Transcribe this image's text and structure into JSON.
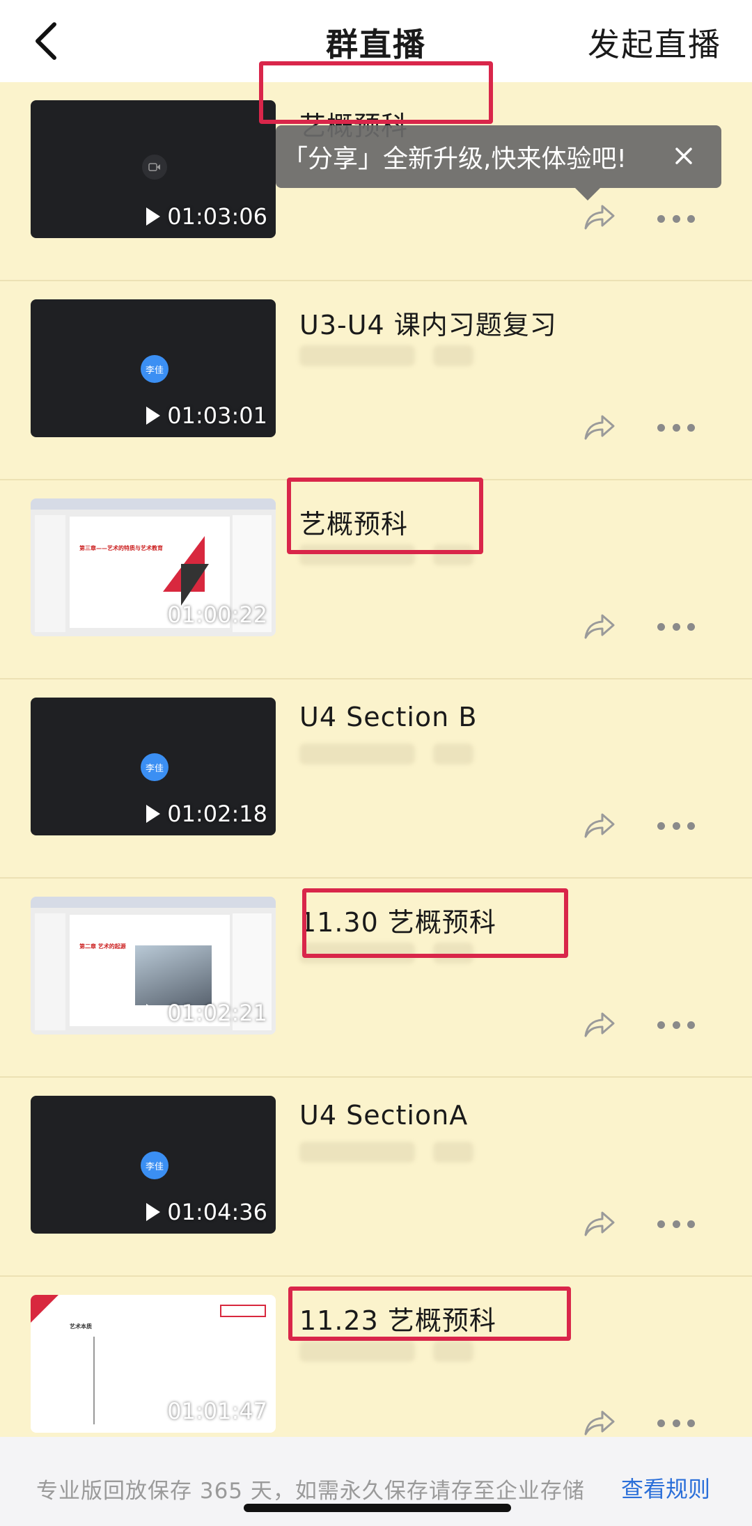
{
  "header": {
    "title": "群直播",
    "action": "发起直播"
  },
  "tooltip": {
    "text": "「分享」全新升级,快来体验吧!"
  },
  "items": [
    {
      "title": "艺概预科",
      "duration": "01:03:06",
      "thumb": "dark-cam",
      "highlighted": true
    },
    {
      "title": "U3-U4 课内习题复习",
      "duration": "01:03:01",
      "thumb": "dark-avatar",
      "avatar": "李佳",
      "highlighted": false
    },
    {
      "title": "艺概预科",
      "duration": "01:00:22",
      "thumb": "slide",
      "slide_text": "第三章——艺术的特质与艺术教育",
      "highlighted": true
    },
    {
      "title": "U4 Section B",
      "duration": "01:02:18",
      "thumb": "dark-avatar",
      "avatar": "李佳",
      "highlighted": false
    },
    {
      "title": "11.30 艺概预科",
      "duration": "01:02:21",
      "thumb": "slide-photo",
      "slide_text": "第二章 艺术的起源",
      "highlighted": true
    },
    {
      "title": "U4 SectionA",
      "duration": "01:04:36",
      "thumb": "dark-avatar",
      "avatar": "李佳",
      "highlighted": false
    },
    {
      "title": "11.23 艺概预科",
      "duration": "01:01:47",
      "thumb": "slide-white",
      "slide_text": "艺术本质",
      "highlighted": true
    }
  ],
  "footer": {
    "text": "专业版回放保存 365 天，如需永久保存请存至企业存储",
    "link": "查看规则"
  },
  "colors": {
    "background": "#fbf3cc",
    "highlight": "#d9264a",
    "link": "#2b6fd9"
  }
}
